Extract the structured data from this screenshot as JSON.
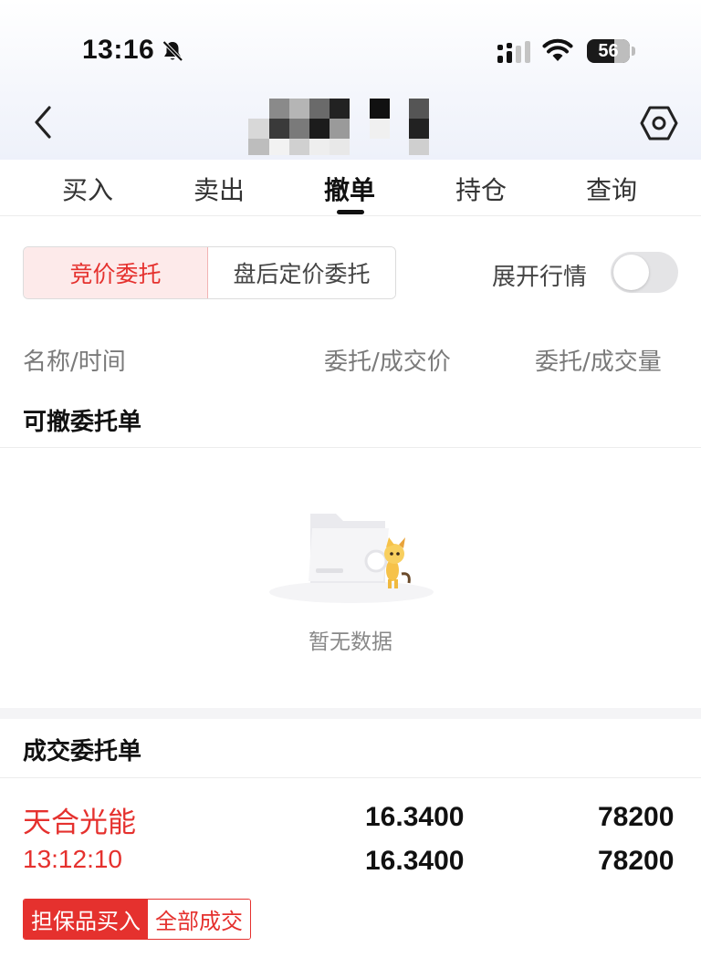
{
  "status_bar": {
    "time": "13:16",
    "battery_level": "56"
  },
  "nav": {
    "back_icon": "chevron-left-icon",
    "settings_icon": "hexagon-settings-icon"
  },
  "tabs": [
    {
      "label": "买入",
      "active": false
    },
    {
      "label": "卖出",
      "active": false
    },
    {
      "label": "撤单",
      "active": true
    },
    {
      "label": "持仓",
      "active": false
    },
    {
      "label": "查询",
      "active": false
    }
  ],
  "segment": {
    "options": [
      "竞价委托",
      "盘后定价委托"
    ],
    "selected": "竞价委托"
  },
  "market_toggle": {
    "label": "展开行情",
    "on": false
  },
  "columns": {
    "name_time": "名称/时间",
    "price": "委托/成交价",
    "volume": "委托/成交量"
  },
  "cancelable_section": {
    "title": "可撤委托单",
    "empty_text": "暂无数据"
  },
  "filled_section": {
    "title": "成交委托单",
    "orders": [
      {
        "name": "天合光能",
        "time": "13:12:10",
        "order_price": "16.3400",
        "deal_price": "16.3400",
        "order_volume": "78200",
        "deal_volume": "78200",
        "type_tag": "担保品买入",
        "status_tag": "全部成交"
      }
    ]
  },
  "colors": {
    "accent_red": "#e5312e",
    "active_segment_bg": "#fdeaea",
    "muted_text": "#7a7a7a"
  }
}
